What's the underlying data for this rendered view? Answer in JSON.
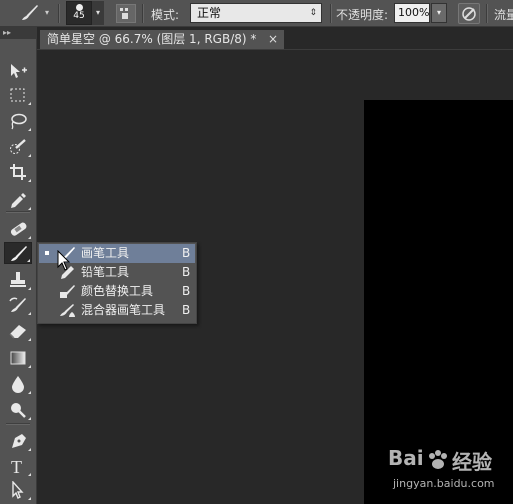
{
  "options_bar": {
    "brush_size": "45",
    "mode_label": "模式:",
    "mode_value": "正常",
    "opacity_label": "不透明度:",
    "opacity_value": "100%",
    "flow_label": "流量"
  },
  "document_tab": {
    "title": "简单星空 @ 66.7% (图层 1, RGB/8) *",
    "close": "×"
  },
  "toolbar": {
    "collapse": "▸▸",
    "tools": [
      "move-tool",
      "marquee-tool",
      "lasso-tool",
      "quick-selection-tool",
      "crop-tool",
      "eyedropper-tool",
      "spot-healing-tool",
      "brush-tool",
      "clone-stamp-tool",
      "history-brush-tool",
      "eraser-tool",
      "gradient-tool",
      "blur-tool",
      "dodge-tool",
      "pen-tool",
      "type-tool",
      "path-selection-tool"
    ],
    "type_tool_glyph": "T"
  },
  "flyout": {
    "items": [
      {
        "name": "画笔工具",
        "key": "B",
        "selected": true
      },
      {
        "name": "铅笔工具",
        "key": "B",
        "selected": false
      },
      {
        "name": "颜色替换工具",
        "key": "B",
        "selected": false
      },
      {
        "name": "混合器画笔工具",
        "key": "B",
        "selected": false
      }
    ]
  },
  "watermark": {
    "logo_left": "Bai",
    "logo_right": "经验",
    "url": "jingyan.baidu.com"
  },
  "colors": {
    "panel": "#535353",
    "workspace": "#282828",
    "canvas": "#000000",
    "selection": "#6f7f99"
  }
}
